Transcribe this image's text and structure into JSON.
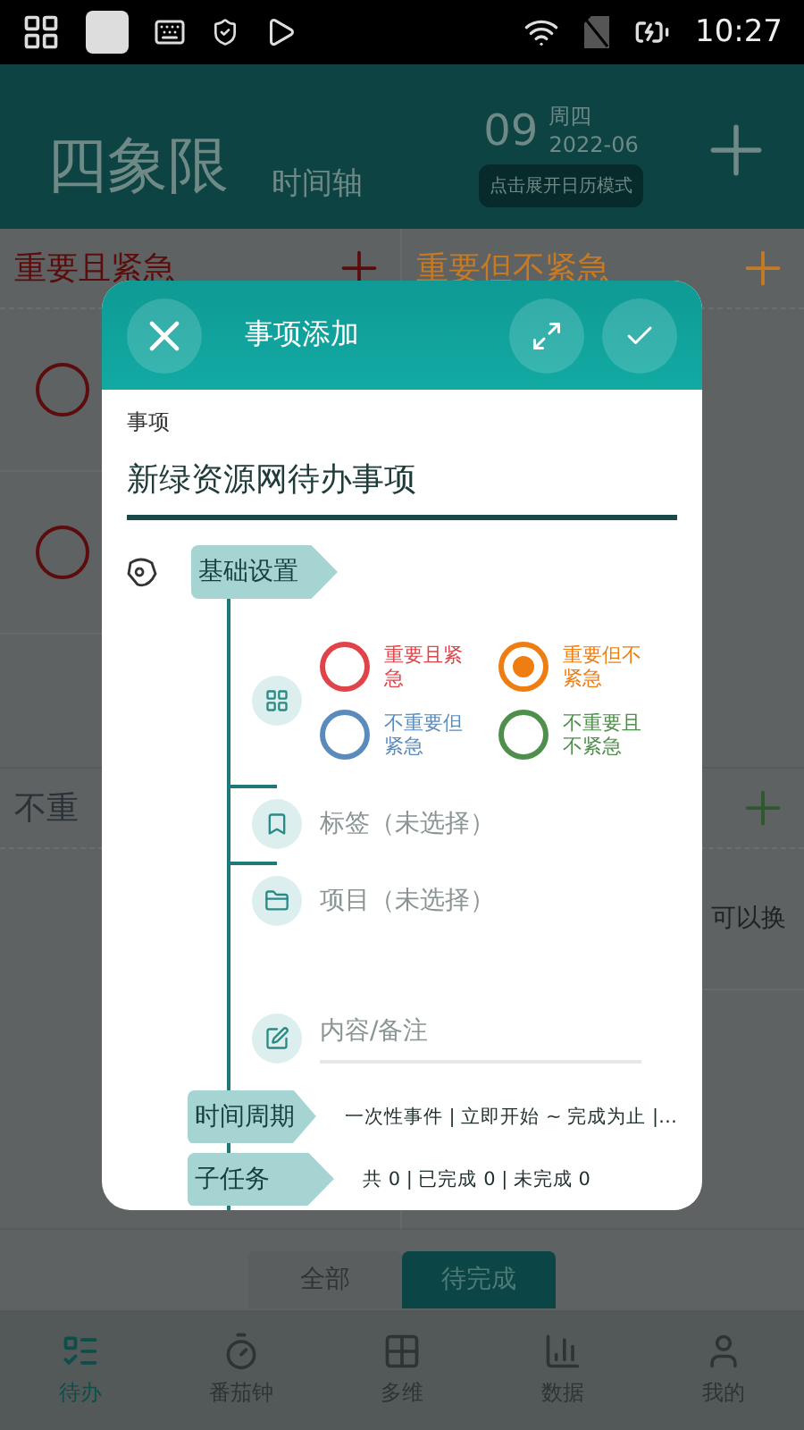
{
  "status_bar": {
    "time": "10:27"
  },
  "header": {
    "title": "四象限",
    "tab": "时间轴",
    "day": "09",
    "weekday": "周四",
    "month": "2022-06",
    "hint": "点击展开日历模式"
  },
  "quadrants": [
    {
      "title": "重要且紧急",
      "color": "#5c0c0c",
      "add_button": true,
      "tasks": [
        {
          "checked": false
        },
        {
          "checked": false
        }
      ]
    },
    {
      "title": "重要但不紧急",
      "color": "#c77a24",
      "add_button": true
    },
    {
      "title": "不重",
      "color": "#2a3238"
    },
    {
      "color": "#2c5a2c",
      "add_button": true,
      "tasks": [
        {
          "text": "可以换"
        }
      ]
    }
  ],
  "filter_tabs": [
    {
      "label": "全部",
      "selected": false
    },
    {
      "label": "待完成",
      "selected": true
    }
  ],
  "bottom_nav": [
    {
      "label": "待办",
      "selected": true
    },
    {
      "label": "番茄钟",
      "selected": false
    },
    {
      "label": "多维",
      "selected": false
    },
    {
      "label": "数据",
      "selected": false
    },
    {
      "label": "我的",
      "selected": false
    }
  ],
  "dialog": {
    "title": "事项添加",
    "field_label": "事项",
    "value": "新绿资源网待办事项",
    "basic": {
      "tag": "基础设置",
      "priorities": [
        {
          "label": "重要且紧急",
          "color": "#e0444a",
          "selected": false
        },
        {
          "label": "重要但不紧急",
          "color": "#ee7d12",
          "selected": true
        },
        {
          "label": "不重要但紧急",
          "color": "#5b8bbd",
          "selected": false
        },
        {
          "label": "不重要且不紧急",
          "color": "#4f8f4c",
          "selected": false
        }
      ],
      "rows": [
        {
          "kind": "tag",
          "text": "标签（未选择）"
        },
        {
          "kind": "project",
          "text": "项目（未选择）"
        },
        {
          "kind": "note",
          "placeholder": "内容/备注"
        }
      ]
    },
    "time_cycle": {
      "tag": "时间周期",
      "text": "一次性事件 | 立即开始 ~ 完成为止 |…"
    },
    "subtasks": {
      "tag": "子任务",
      "text": "共 0 | 已完成 0 | 未完成 0"
    }
  }
}
